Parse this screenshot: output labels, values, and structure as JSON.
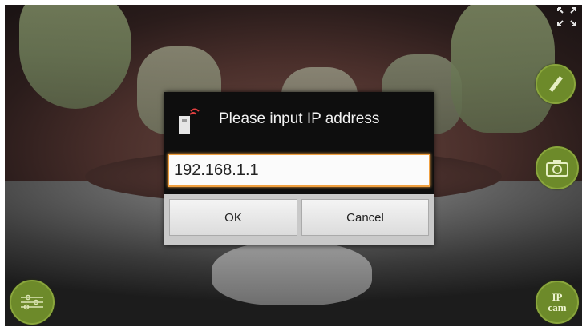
{
  "dialog": {
    "title": "Please input IP address",
    "input_value": "192.168.1.1",
    "ok_label": "OK",
    "cancel_label": "Cancel",
    "icon": "wifi-camera-icon"
  },
  "controls": {
    "fullscreen_icon": "fullscreen-toggle-icon",
    "pen_icon": "pen-icon",
    "camera_icon": "camera-icon",
    "ipcam_label_top": "IP",
    "ipcam_label_bottom": "cam",
    "bottom_left_icon": "settings-icon"
  },
  "colors": {
    "accent_green": "#6d8a2a",
    "input_focus": "#f0a040"
  }
}
